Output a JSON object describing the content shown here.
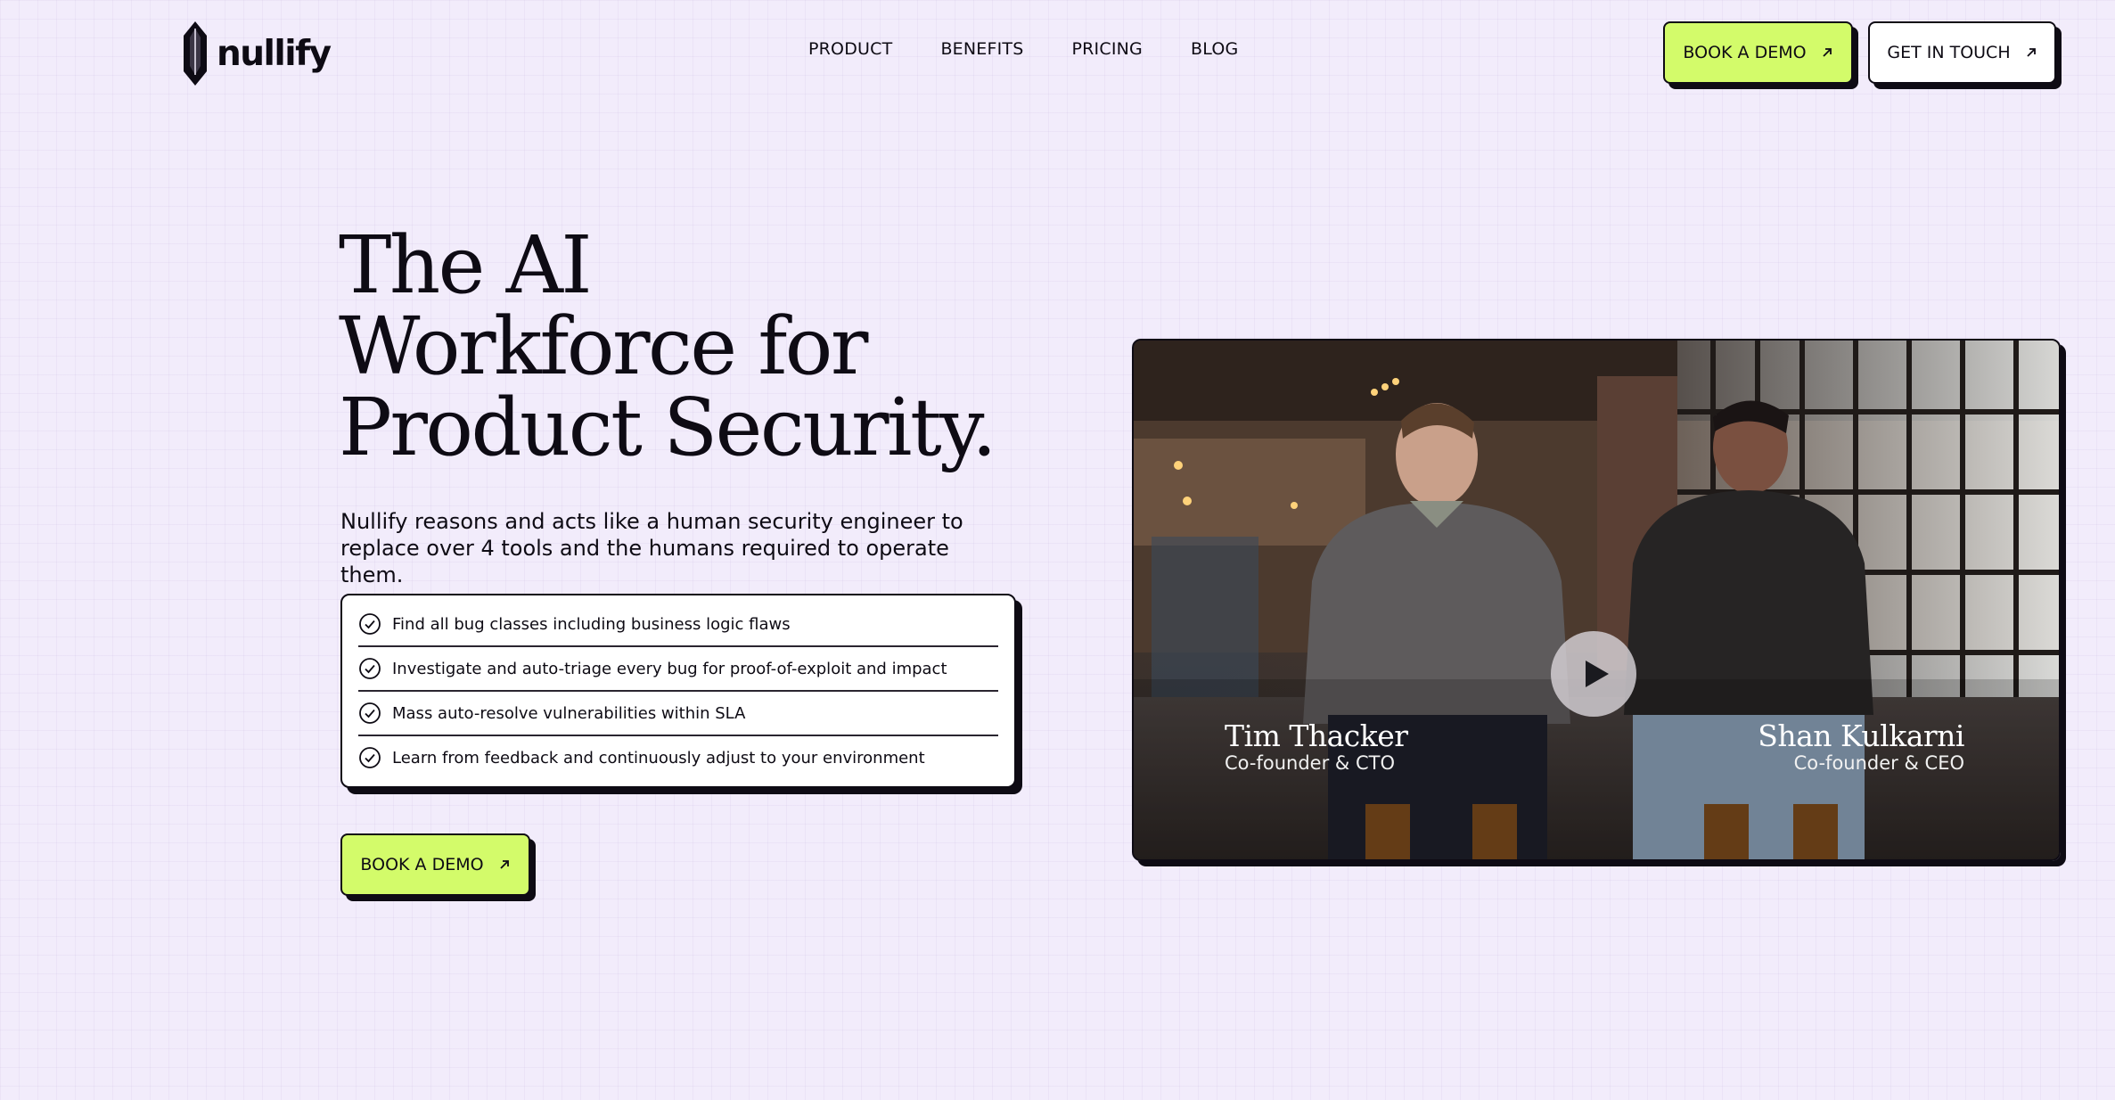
{
  "brand": {
    "name": "nullify",
    "logo_icon": "crystal-shield-icon"
  },
  "nav": {
    "items": [
      "PRODUCT",
      "BENEFITS",
      "PRICING",
      "BLOG"
    ]
  },
  "header_actions": {
    "book_demo_label": "BOOK A DEMO",
    "get_in_touch_label": "GET IN TOUCH",
    "arrow_icon": "arrow-up-right-icon"
  },
  "hero": {
    "title_lines": [
      "The AI",
      "Workforce for",
      "Product Security."
    ],
    "subtitle": "Nullify reasons and acts like a human security engineer to replace over 4 tools and the humans required to operate them.",
    "features": [
      "Find all bug classes including business logic flaws",
      "Investigate and auto-triage every bug for proof-of-exploit and impact",
      "Mass auto-resolve vulnerabilities within SLA",
      "Learn from feedback and continuously adjust to your environment"
    ],
    "feature_icon": "check-circle-icon",
    "cta_label": "BOOK A DEMO"
  },
  "video": {
    "play_icon": "play-icon",
    "people": [
      {
        "name": "Tim Thacker",
        "role": "Co-founder & CTO"
      },
      {
        "name": "Shan Kulkarni",
        "role": "Co-founder & CEO"
      }
    ]
  },
  "colors": {
    "background": "#f2ecfb",
    "accent_lime": "#d3fb6a",
    "ink": "#0e0b14",
    "card": "#ffffff"
  }
}
